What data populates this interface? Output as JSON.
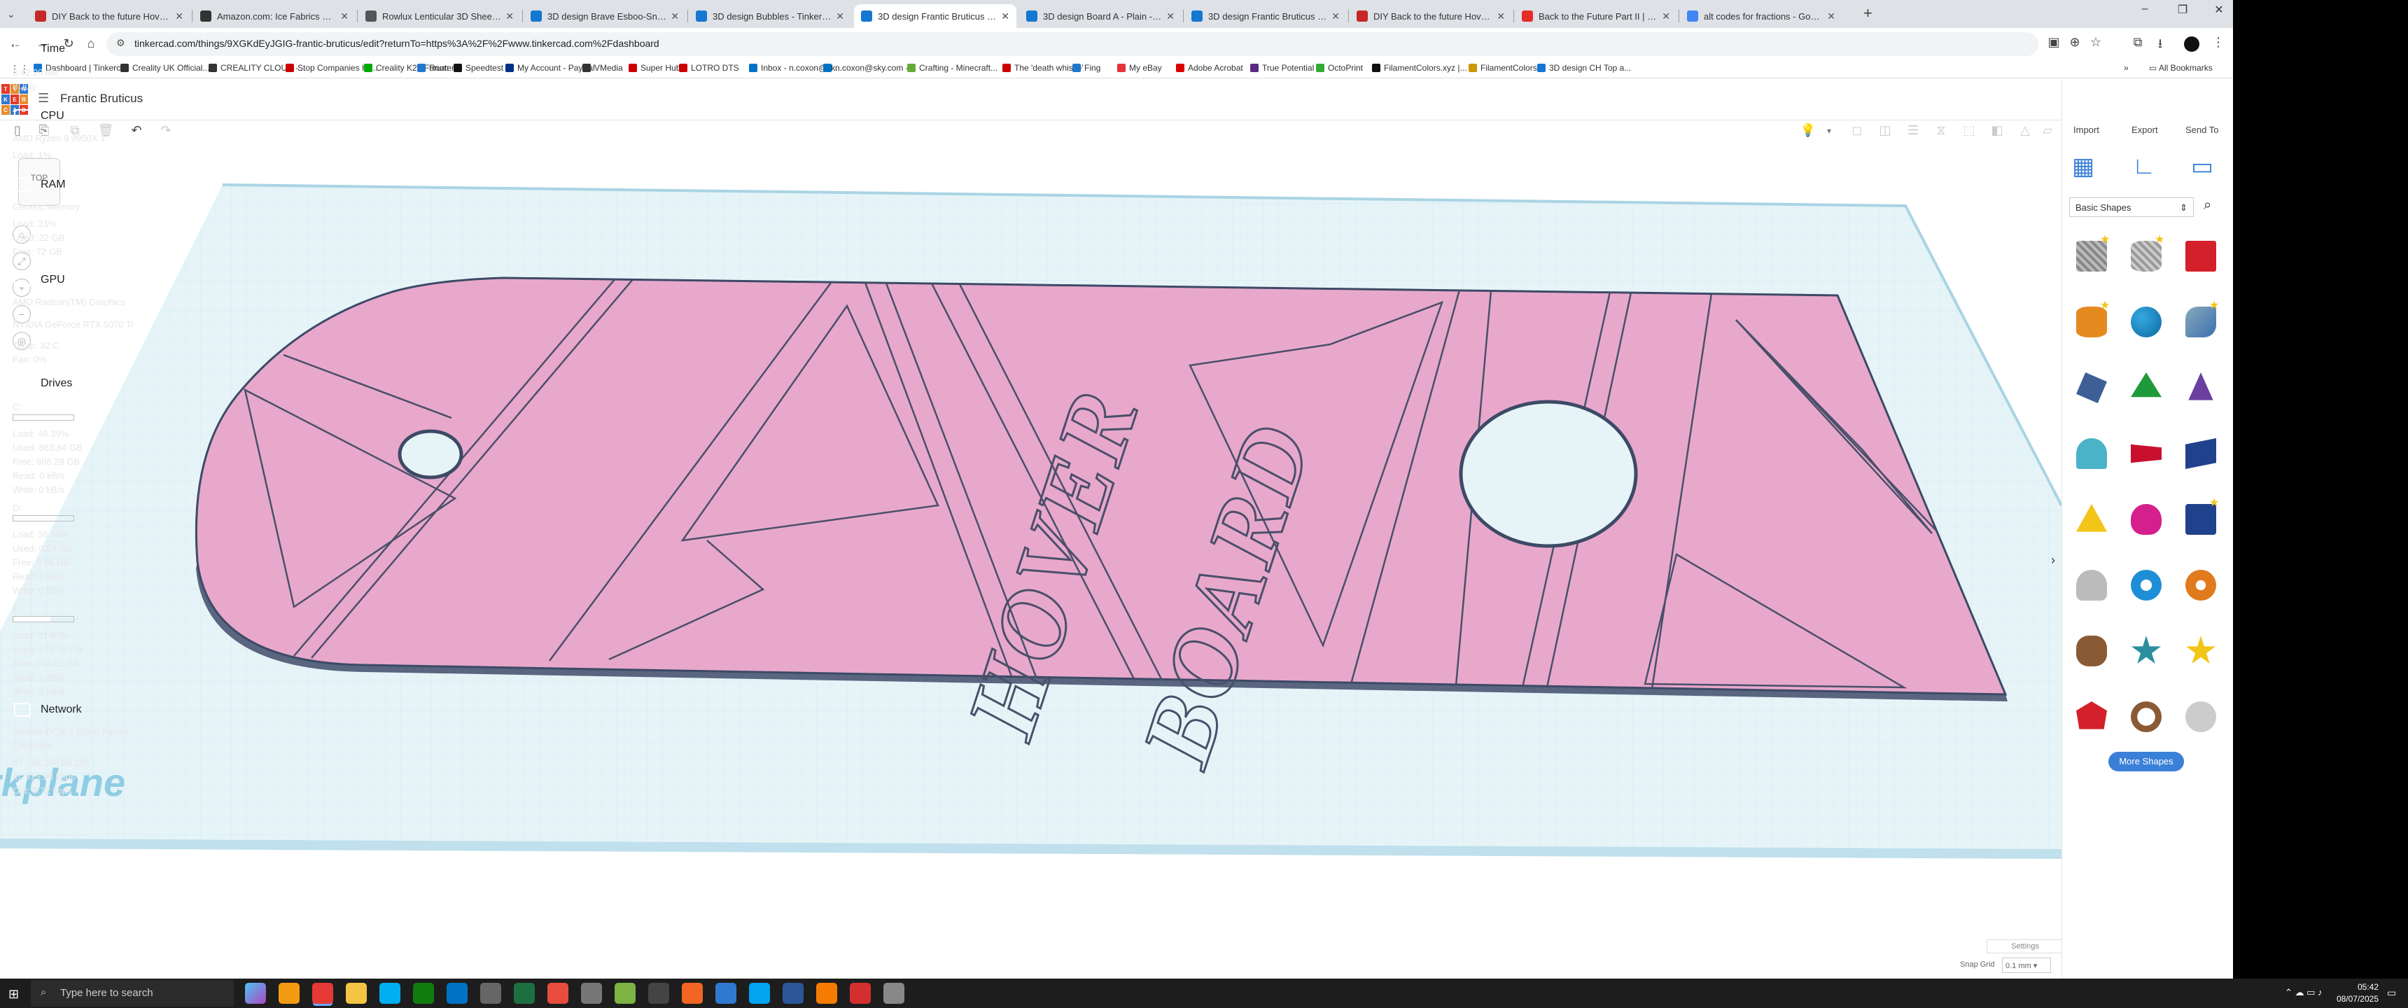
{
  "tabs": [
    {
      "label": "DIY Back to the future Hoverbo",
      "color": "#c62828"
    },
    {
      "label": "Amazon.com: Ice Fabrics Faux L",
      "color": "#333333"
    },
    {
      "label": "Rowlux Lenticular 3D Sheet - 6",
      "color": "#555555"
    },
    {
      "label": "3D design Brave Esboo-Snickel",
      "color": "#1477d1"
    },
    {
      "label": "3D design Bubbles - Tinkercad",
      "color": "#1477d1"
    },
    {
      "label": "3D design Frantic Bruticus - Tin",
      "color": "#1477d1"
    },
    {
      "label": "3D design Board A - Plain - Tin",
      "color": "#1477d1"
    },
    {
      "label": "3D design Frantic Bruticus - Tin",
      "color": "#1477d1"
    },
    {
      "label": "DIY Back to the future Hoverbo",
      "color": "#c62828"
    },
    {
      "label": "Back to the Future Part II | Hov",
      "color": "#e52d27"
    },
    {
      "label": "alt codes for fractions - Google",
      "color": "#4285f4"
    }
  ],
  "url": "tinkercad.com/things/9XGKdEyJGIG-frantic-bruticus/edit?returnTo=https%3A%2F%2Fwww.tinkercad.com%2Fdashboard",
  "bookmarks": [
    {
      "label": "Dashboard | Tinkerc...",
      "color": "#1477d1"
    },
    {
      "label": "Creality UK Official...",
      "color": "#333"
    },
    {
      "label": "CREALITY CLOUD -...",
      "color": "#333"
    },
    {
      "label": "Stop Companies Ho...",
      "color": "#c00"
    },
    {
      "label": "Creality K2+ Forum",
      "color": "#0a0"
    },
    {
      "label": "Router",
      "color": "#2277cc"
    },
    {
      "label": "Speedtest",
      "color": "#111"
    },
    {
      "label": "My Account - PayPal",
      "color": "#003087"
    },
    {
      "label": "VMedia",
      "color": "#333"
    },
    {
      "label": "Super Hub",
      "color": "#c00"
    },
    {
      "label": "LOTRO DTS",
      "color": "#c00"
    },
    {
      "label": "Inbox - n.coxon@sk...",
      "color": "#0072c6"
    },
    {
      "label": "n.coxon@sky.com -...",
      "color": "#0072c6"
    },
    {
      "label": "Crafting - Minecraft...",
      "color": "#6a3"
    },
    {
      "label": "The 'death whistle'",
      "color": "#c00"
    },
    {
      "label": "Fing",
      "color": "#2277cc"
    },
    {
      "label": "My eBay",
      "color": "#e53238"
    },
    {
      "label": "Adobe Acrobat",
      "color": "#d00"
    },
    {
      "label": "True Potential",
      "color": "#5a2a82"
    },
    {
      "label": "OctoPrint",
      "color": "#3a3"
    },
    {
      "label": "FilamentColors.xyz |...",
      "color": "#111"
    },
    {
      "label": "FilamentColors",
      "color": "#c90"
    },
    {
      "label": "3D design CH Top a...",
      "color": "#1477d1"
    }
  ],
  "all_bookmarks": "All Bookmarks",
  "window_controls": {
    "min": "–",
    "max": "❐",
    "close": "✕"
  },
  "design_name": "Frantic Bruticus",
  "viewcube_label": "TOP",
  "watermark": "rkplane",
  "panel": {
    "import": "Import",
    "export": "Export",
    "send_to": "Send To",
    "library": "Basic Shapes",
    "more_shapes": "More Shapes"
  },
  "bottom": {
    "settings": "Settings",
    "snap_label": "Snap Grid",
    "snap_value": "0.1 mm"
  },
  "monitor": {
    "time_h": "Time",
    "time": "5:42:20 AM",
    "date": "8 July",
    "cpu_h": "CPU",
    "cpu_name": "AMD Ryzen 9 9950X 1",
    "cpu_load": "Load: 1%",
    "ram_h": "RAM",
    "ram_name": "Generic Memory",
    "ram_load": "Load: 23%",
    "ram_used": "Used: 22 GB",
    "ram_free": "Free: 72 GB",
    "gpu_h": "GPU",
    "gpu_name1": "AMD Radeon(TM) Graphics",
    "gpu_name2": "NVIDIA GeForce RTX 5070 Ti",
    "gpu_temp": "Temp: 32 C",
    "gpu_fan": "Fan: 0%",
    "drives_h": "Drives",
    "drives": [
      {
        "name": "C:",
        "load": "Load: 46.39%",
        "used": "Used: 863.84 GB",
        "free": "Free: 998.29 GB",
        "read": "Read: 0 kB/s",
        "write": "Write: 0 kB/s",
        "fill": 0.4639
      },
      {
        "name": "D:",
        "load": "Load: 36.36%",
        "used": "Used: 0.04 GB",
        "free": "Free: 0.06 GB",
        "read": "Read: 0 kB/s",
        "write": "Write: 0 kB/s",
        "fill": 0.3636
      },
      {
        "name": "F:",
        "load": "Load: 61.97%",
        "used": "Used: 577.18 GB",
        "free": "Free: 354.23 GB",
        "read": "Read: 0 kB/s",
        "write": "Write: 0 kB/s",
        "fill": 0.6197
      }
    ],
    "net_h": "Network",
    "net_name1": "Realtek PCIe 2.5GbE Family",
    "net_name2": "Controller",
    "ip": "IP: 192.168.86.206",
    "net_in": "In: 915.98 kbps",
    "net_out": "Out: 8.72 kbps"
  },
  "taskbar": {
    "search_placeholder": "Type here to search",
    "time": "05:42",
    "date": "08/07/2025"
  },
  "colors": {
    "board": "#e8a8cc",
    "board_edge": "#3d4a66",
    "workplane": "#e8f4f8",
    "grid": "#c9e6ef",
    "accent": "#3a80d9"
  }
}
